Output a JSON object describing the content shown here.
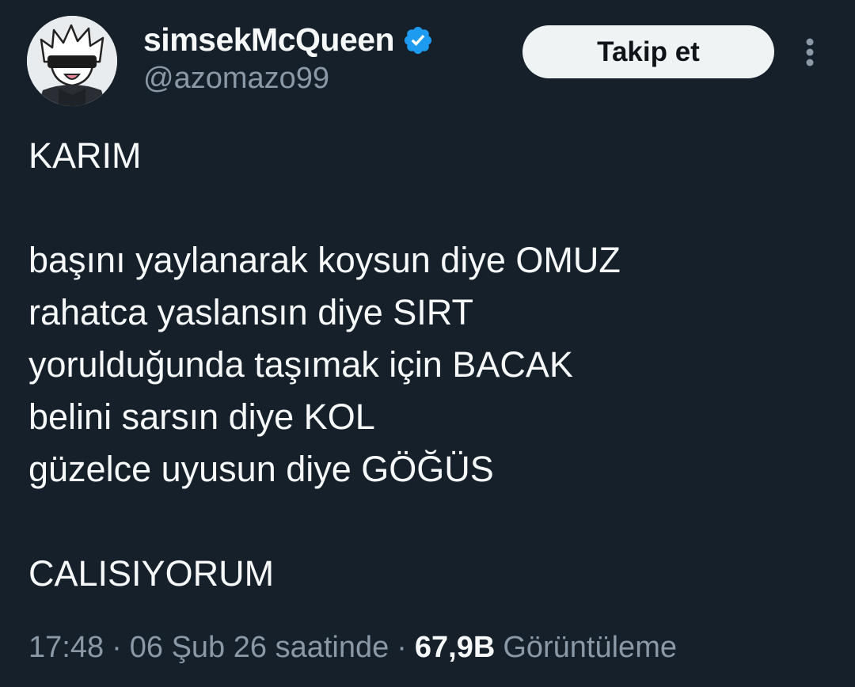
{
  "author": {
    "display_name": "simsekMcQueen",
    "handle": "@azomazo99",
    "verified": true,
    "avatar_icon": "anime-character-avatar"
  },
  "actions": {
    "follow_label": "Takip et",
    "more_icon": "more-vertical-icon"
  },
  "tweet": {
    "heading": "KARIM",
    "lines": [
      "başını yaylanarak koysun diye OMUZ",
      "rahatca yaslansın diye SIRT",
      "yorulduğunda taşımak için BACAK",
      "belini sarsın diye KOL",
      "güzelce uyusun diye GÖĞÜS"
    ],
    "closing": "CALISIYORUM"
  },
  "meta": {
    "time": "17:48",
    "date": "06 Şub 26 saatinde",
    "separator": "·",
    "views_count": "67,9B",
    "views_label": "Görüntüleme"
  },
  "colors": {
    "background": "#15202b",
    "text_primary": "#f7f9f9",
    "text_secondary": "#8b98a5",
    "verified_badge": "#1d9bf0",
    "follow_button_bg": "#eff3f4"
  }
}
